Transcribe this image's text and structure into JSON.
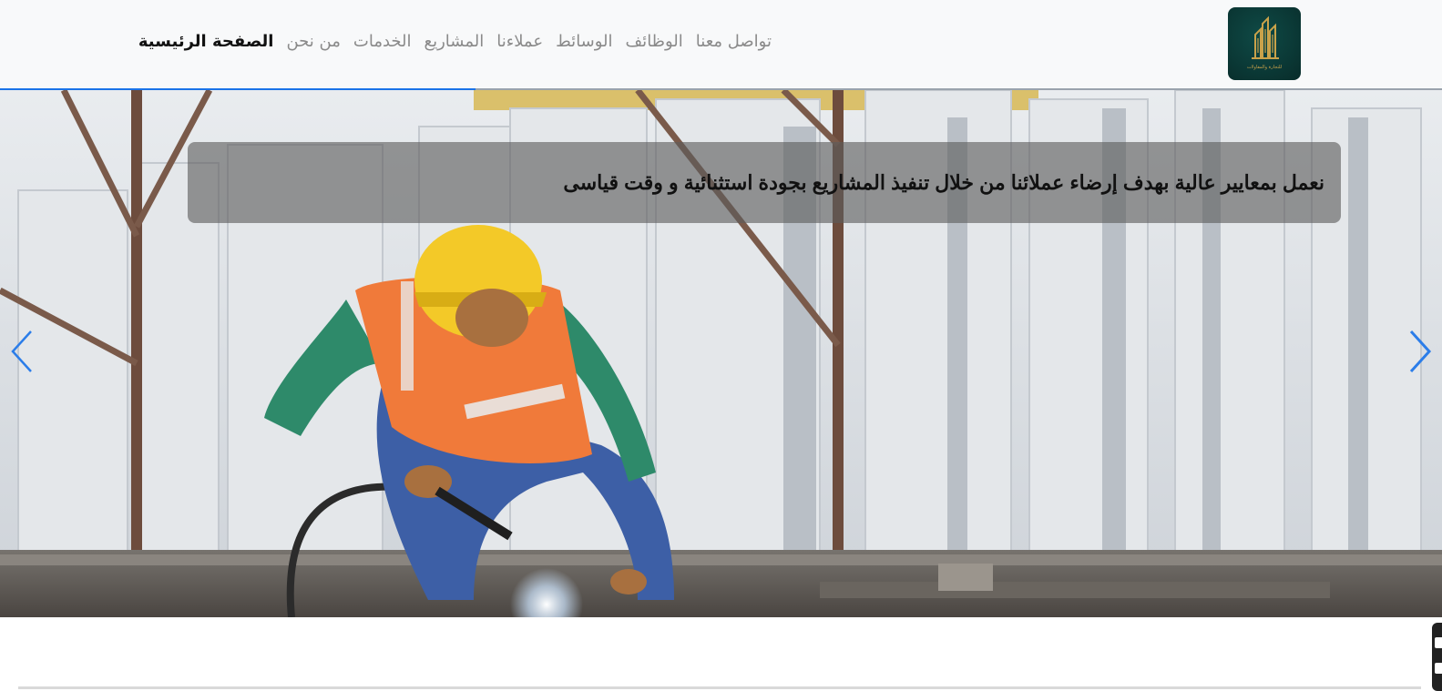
{
  "header": {
    "logo": {
      "icon": "building-logo-icon",
      "caption": "للتجارة والمقاولات"
    },
    "nav": [
      {
        "label": "الصفحة الرئيسية",
        "active": true
      },
      {
        "label": "من نحن",
        "active": false
      },
      {
        "label": "الخدمات",
        "active": false
      },
      {
        "label": "المشاريع",
        "active": false
      },
      {
        "label": "عملاءنا",
        "active": false
      },
      {
        "label": "الوسائط",
        "active": false
      },
      {
        "label": "الوظائف",
        "active": false
      },
      {
        "label": "تواصل معنا",
        "active": false
      }
    ]
  },
  "hero": {
    "slide_progress": 0.33,
    "caption": "نعمل بمعايير عالية بهدف إرضاء عملائنا من خلال تنفيذ المشاريع بجودة استثنائية و وقت قياسى",
    "prev_icon": "chevron-left-icon",
    "next_icon": "chevron-right-icon"
  },
  "colors": {
    "accent": "#1a73e8",
    "logo_bg": "#0b3a37",
    "logo_gold": "#c9a24a",
    "nav_active": "#111111",
    "nav_inactive": "#8a8a8a"
  }
}
